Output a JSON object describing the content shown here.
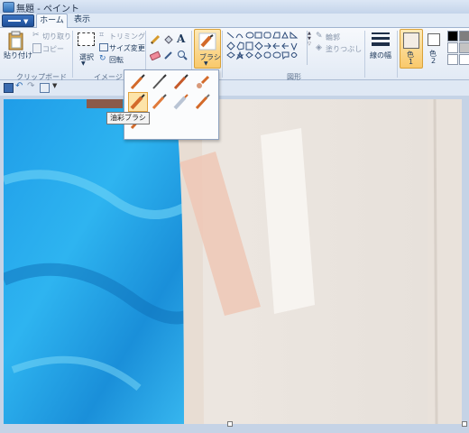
{
  "window": {
    "title": "無題 - ペイント"
  },
  "tabs": [
    {
      "label": "ホーム"
    },
    {
      "label": "表示"
    }
  ],
  "ribbon": {
    "clipboard": {
      "paste_label": "貼り付け",
      "cut_label": "切り取り",
      "copy_label": "コピー",
      "group_label": "クリップボード"
    },
    "image": {
      "select_label": "選択",
      "crop_label": "トリミング",
      "resize_label": "サイズ変更",
      "rotate_label": "回転",
      "group_label": "イメージ"
    },
    "brush": {
      "label": "ブラシ"
    },
    "shapes": {
      "outline_label": "輪郭",
      "fill_label": "塗りつぶし",
      "group_label": "図形"
    },
    "size": {
      "label": "線の幅"
    },
    "colors": {
      "color1_label": "色",
      "color1_num": "1",
      "color2_label": "色",
      "color2_num": "2"
    }
  },
  "brush_popup": {
    "tooltip": "油彩ブラシ",
    "selected_index": 4,
    "count": 9
  },
  "colors_map": {
    "accent": "#e3a33e",
    "ribbon_bg": "#f7f9fc",
    "file_button": "#2a60ad"
  }
}
